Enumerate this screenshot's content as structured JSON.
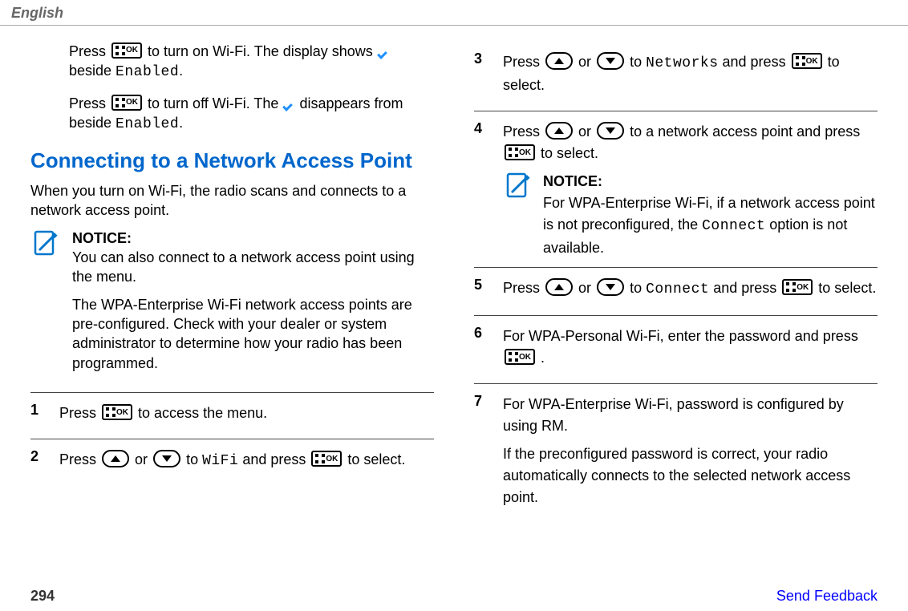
{
  "header": {
    "language": "English"
  },
  "left": {
    "para1": {
      "a": "Press ",
      "b": " to turn on Wi-Fi. The display shows ",
      "c": " beside ",
      "enabled": "Enabled",
      "d": "."
    },
    "para2": {
      "a": "Press ",
      "b": " to turn off Wi-Fi. The ",
      "c": " disappears from beside ",
      "enabled": "Enabled",
      "d": "."
    },
    "heading": "Connecting to a Network Access Point",
    "intro": "When you turn on Wi-Fi, the radio scans and connects to a network access point.",
    "notice": {
      "label": "NOTICE:",
      "p1": "You can also connect to a network access point using the menu.",
      "p2": "The WPA-Enterprise Wi-Fi network access points are pre-configured. Check with your dealer or system administrator to determine how your radio has been programmed."
    },
    "steps": {
      "s1": {
        "a": "Press ",
        "b": " to access the menu."
      },
      "s2": {
        "a": "Press ",
        "b": " or ",
        "c": " to ",
        "wifi": "WiFi",
        "d": " and press ",
        "e": " to select."
      }
    }
  },
  "right": {
    "steps": {
      "s3": {
        "a": "Press ",
        "b": " or ",
        "c": " to ",
        "networks": "Networks",
        "d": " and press ",
        "e": " to select."
      },
      "s4": {
        "a": "Press ",
        "b": " or ",
        "c": " to a network access point and press ",
        "d": " to select.",
        "notice": {
          "label": "NOTICE:",
          "text_a": "For WPA-Enterprise Wi-Fi, if a network access point is not preconfigured, the ",
          "connect": "Connect",
          "text_b": " option is not available."
        }
      },
      "s5": {
        "a": "Press ",
        "b": " or ",
        "c": " to ",
        "connect": "Connect",
        "d": " and press ",
        "e": " to select."
      },
      "s6": {
        "a": "For WPA-Personal Wi-Fi, enter the password and press ",
        "b": " ."
      },
      "s7": {
        "p1": "For WPA-Enterprise Wi-Fi, password is configured by using RM.",
        "p2": "If the preconfigured password is correct, your radio automatically connects to the selected network access point."
      }
    }
  },
  "footer": {
    "page": "294",
    "link": "Send Feedback"
  }
}
